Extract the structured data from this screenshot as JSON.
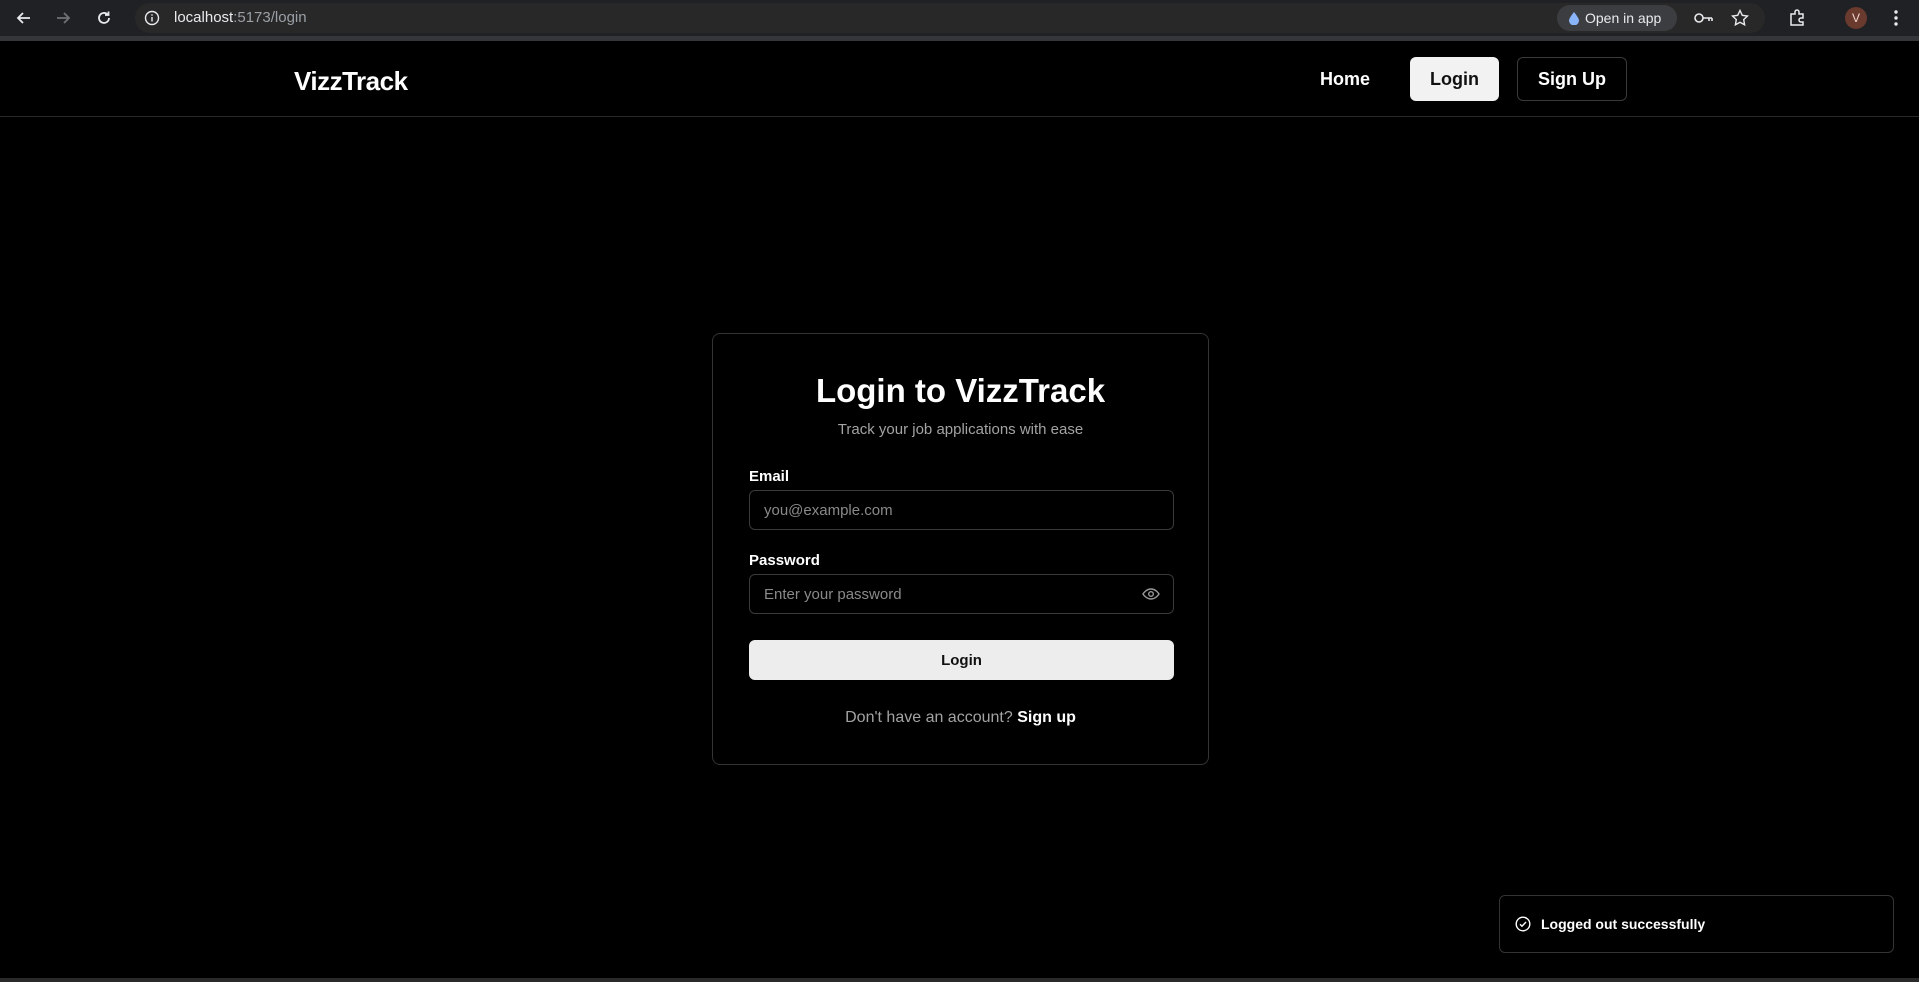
{
  "browser": {
    "url_host": "localhost",
    "url_path": ":5173/login",
    "open_in_app_label": "Open in app",
    "profile_initial": "V"
  },
  "nav": {
    "brand": "VizzTrack",
    "home_label": "Home",
    "login_label": "Login",
    "signup_label": "Sign Up"
  },
  "login_card": {
    "title": "Login to VizzTrack",
    "subtitle": "Track your job applications with ease",
    "email_label": "Email",
    "email_placeholder": "you@example.com",
    "password_label": "Password",
    "password_placeholder": "Enter your password",
    "submit_label": "Login",
    "footer_text": "Don't have an account?",
    "footer_link": "Sign up"
  },
  "toast": {
    "message": "Logged out successfully"
  },
  "colors": {
    "background": "#000000",
    "primary_button": "#ededed",
    "muted_text": "#a3a3a3",
    "border": "#333333"
  }
}
